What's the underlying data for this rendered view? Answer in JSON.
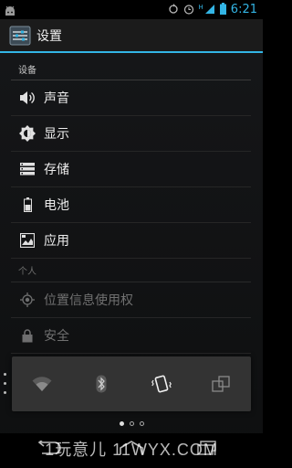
{
  "status_bar": {
    "time": "6:21",
    "network": "H"
  },
  "action_bar": {
    "title": "设置"
  },
  "sections": {
    "device": "设备",
    "personal": "个人"
  },
  "items": {
    "sound": "声音",
    "display": "显示",
    "storage": "存储",
    "battery": "电池",
    "apps": "应用",
    "location": "位置信息使用权",
    "security": "安全"
  },
  "quick_toggles": [
    "wifi-icon",
    "bluetooth-icon",
    "vibrate-phone-icon",
    "screen-rotation-icon"
  ],
  "pager": {
    "pages": 3,
    "active": 1
  },
  "watermark": "1玩意儿 11WYX.COM",
  "colors": {
    "accent": "#33b5e5",
    "popup": "#333333"
  }
}
